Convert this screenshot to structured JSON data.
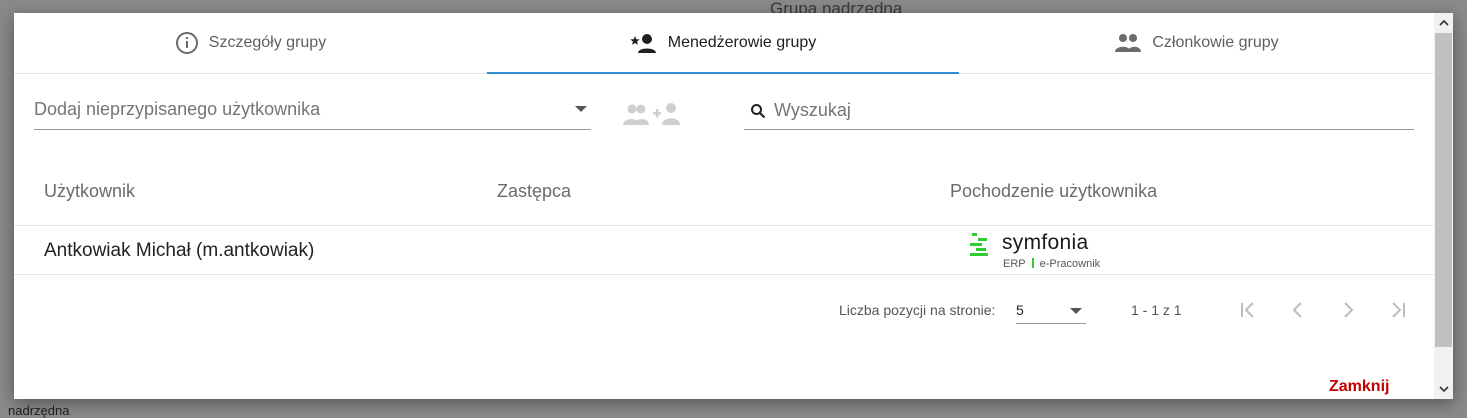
{
  "backdrop": {
    "title_fragment": "Grupa nadrzędna",
    "bottom_fragment": "nadrzędna"
  },
  "tabs": [
    {
      "label": "Szczegóły grupy",
      "icon": "info-icon",
      "active": false
    },
    {
      "label": "Menedżerowie grupy",
      "icon": "manager-star-person-icon",
      "active": true
    },
    {
      "label": "Członkowie grupy",
      "icon": "group-people-icon",
      "active": false
    }
  ],
  "toolbar": {
    "assign_placeholder": "Dodaj nieprzypisanego użytkownika",
    "add_icon": "group-add-icon",
    "search_placeholder": "Wyszukaj",
    "search_icon": "search-icon"
  },
  "table": {
    "headers": [
      "Użytkownik",
      "Zastępca",
      "Pochodzenie użytkownika"
    ],
    "rows": [
      {
        "user": "Antkowiak Michał (m.antkowiak)",
        "deputy": "",
        "origin_logo": {
          "name": "symfonia",
          "product_left": "ERP",
          "product_right": "e-Pracownik"
        }
      }
    ]
  },
  "pagination": {
    "per_page_label": "Liczba pozycji na stronie:",
    "per_page_value": "5",
    "range": "1 - 1 z 1",
    "first_icon": "first-page-icon",
    "prev_icon": "chevron-left-icon",
    "next_icon": "chevron-right-icon",
    "last_icon": "last-page-icon"
  },
  "footer": {
    "close_label": "Zamknij"
  },
  "colors": {
    "accent": "#2f8fd6",
    "close_text": "#c40000",
    "logo_green": "#2ecc2e"
  }
}
